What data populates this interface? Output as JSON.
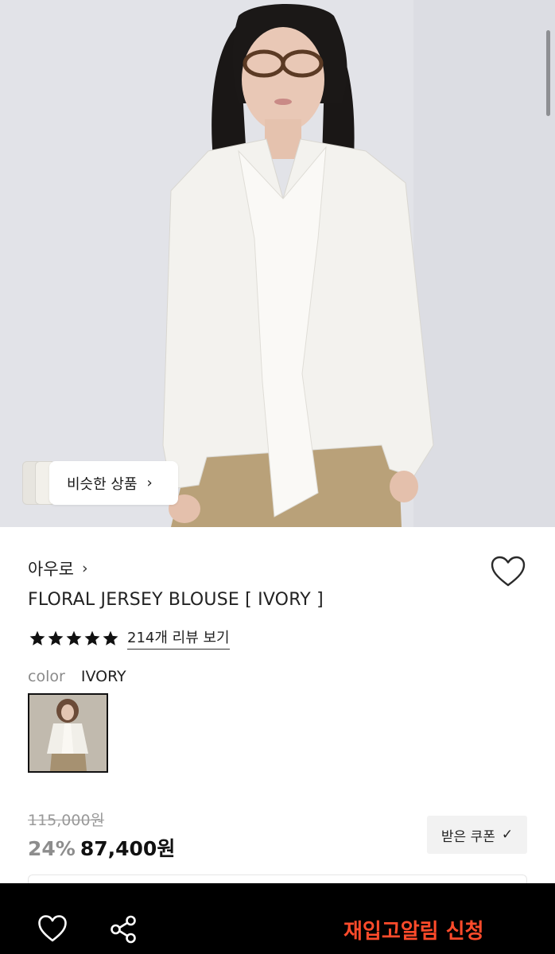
{
  "hero": {
    "similar_button_label": "비슷한 상품",
    "similar_chevron": "›"
  },
  "product": {
    "brand": "아우로",
    "brand_chevron": "›",
    "title": "FLORAL JERSEY BLOUSE [ IVORY ]",
    "rating_stars": 5,
    "review_link": "214개 리뷰 보기",
    "color_key": "color",
    "color_value": "IVORY"
  },
  "pricing": {
    "original_price": "115,000원",
    "discount": "24%",
    "sale_price": "87,400원",
    "coupon_label": "받은 쿠폰",
    "coupon_check": "✓"
  },
  "bottom_bar": {
    "restock_label": "재입고알림 신청"
  },
  "colors": {
    "accent": "#ff4b2b",
    "bottom_bar_bg": "#000000",
    "discount_gray": "#8d8d8d"
  },
  "icons": {
    "wishlist": "heart-icon",
    "share": "share-icon",
    "star": "star-icon"
  }
}
